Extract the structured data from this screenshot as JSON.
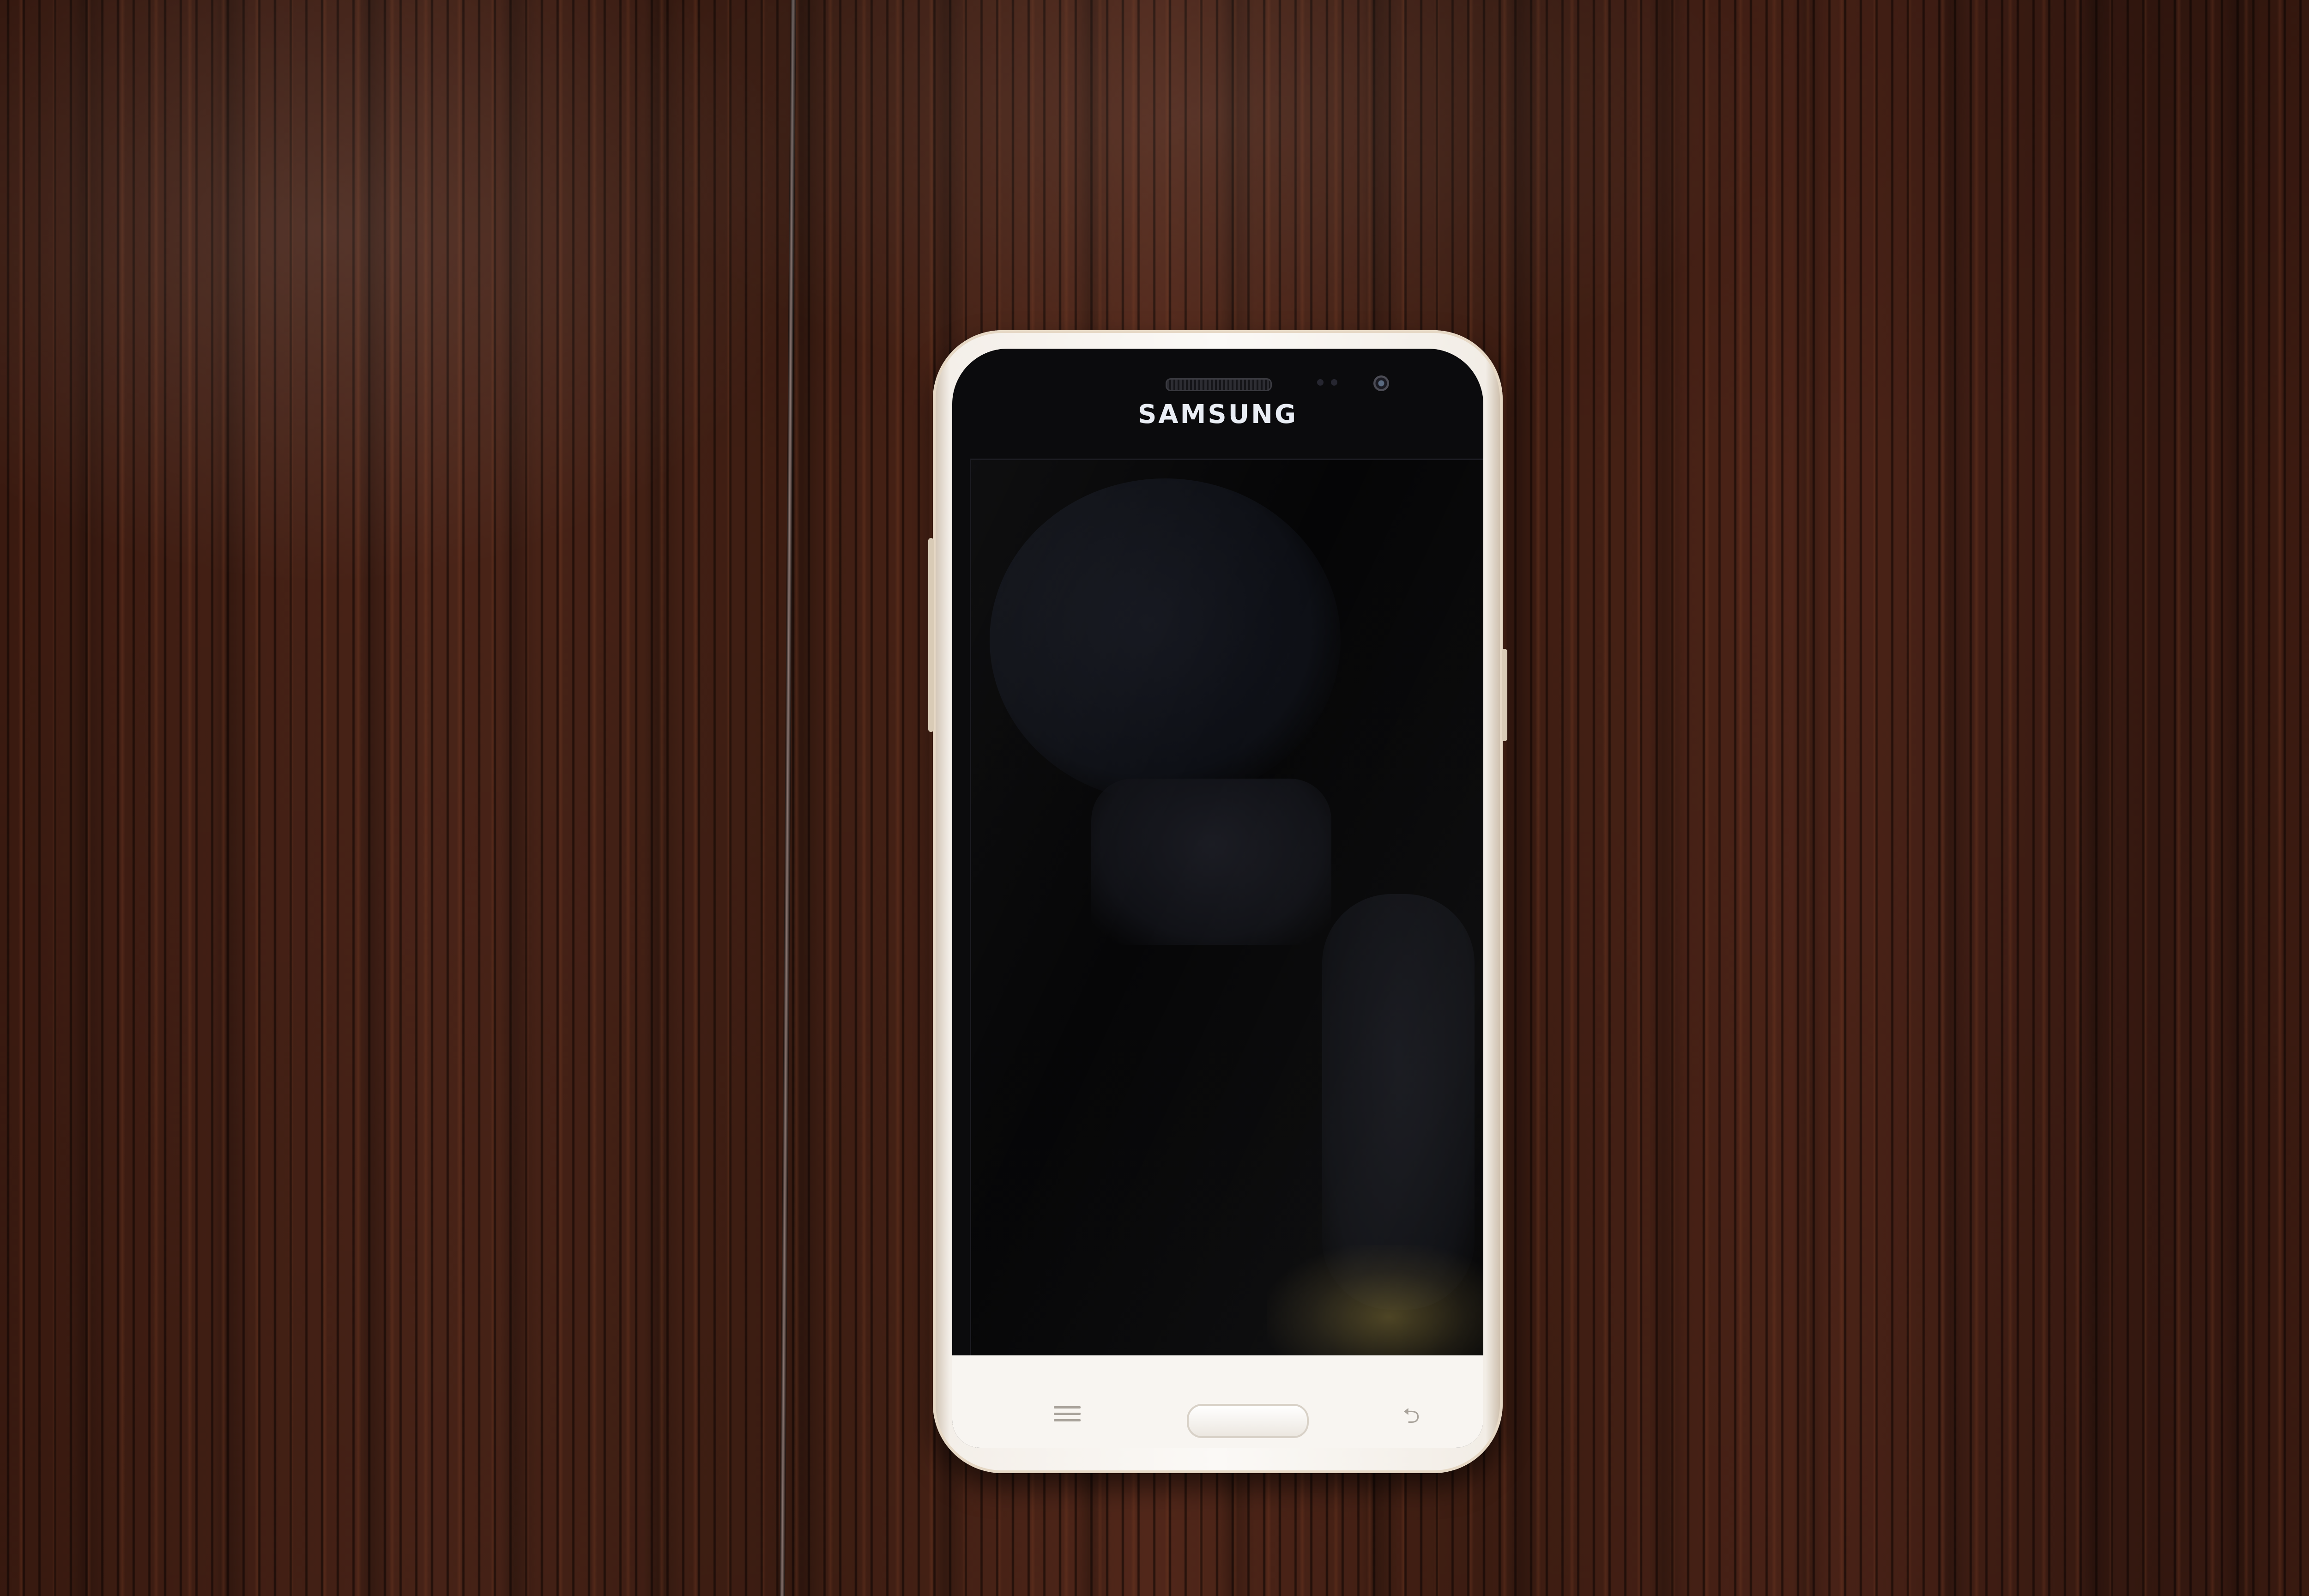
{
  "scene": {
    "table_color": "#3f1c11",
    "phone_body_color": "#f8f5f1",
    "screen_color": "#060607"
  },
  "phone": {
    "brand": "SAMSUNG",
    "icons": {
      "menu_key": "recent-apps-icon",
      "back_key": "back-arrow-icon"
    }
  }
}
